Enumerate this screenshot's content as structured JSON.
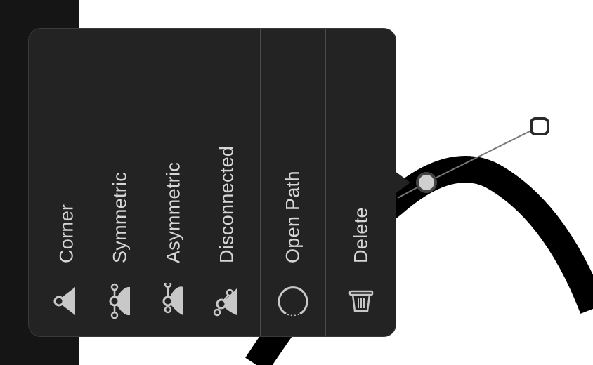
{
  "menu": {
    "items": [
      {
        "label": "Corner",
        "icon": "corner-node-icon"
      },
      {
        "label": "Symmetric",
        "icon": "symmetric-node-icon"
      },
      {
        "label": "Asymmetric",
        "icon": "asymmetric-node-icon"
      },
      {
        "label": "Disconnected",
        "icon": "disconnected-node-icon"
      },
      {
        "label": "Open Path",
        "icon": "open-path-icon"
      },
      {
        "label": "Delete",
        "icon": "trash-icon"
      }
    ]
  },
  "colors": {
    "menu_bg": "#232323",
    "text": "#d6d6d6",
    "icon_fill": "#c8c8c8",
    "sidebar": "#151515",
    "canvas": "#ffffff",
    "path": "#000000"
  }
}
